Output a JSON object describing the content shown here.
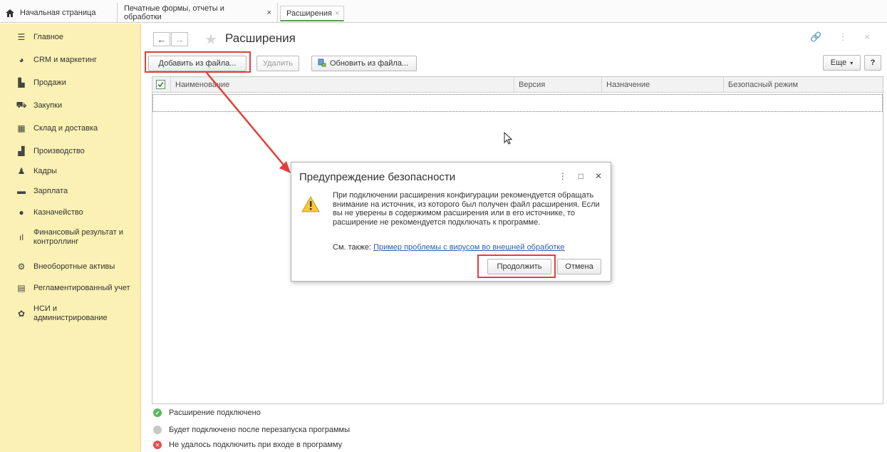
{
  "tabs": [
    {
      "label": "Начальная страница",
      "close": ""
    },
    {
      "label": "Печатные формы, отчеты и обработки",
      "close": "×"
    },
    {
      "label": "Расширения",
      "close": "×"
    }
  ],
  "sidebar": {
    "items": [
      {
        "label": "Главное",
        "icon": "menu-icon"
      },
      {
        "label": "CRM и маркетинг",
        "icon": "pie-chart-icon"
      },
      {
        "label": "Продажи",
        "icon": "shopping-bag-icon"
      },
      {
        "label": "Закупки",
        "icon": "cart-icon"
      },
      {
        "label": "Склад и доставка",
        "icon": "warehouse-icon"
      },
      {
        "label": "Производство",
        "icon": "factory-icon"
      },
      {
        "label": "Кадры",
        "icon": "person-icon"
      },
      {
        "label": "Зарплата",
        "icon": "money-icon"
      },
      {
        "label": "Казначейство",
        "icon": "coin-icon"
      },
      {
        "label": "Финансовый результат и контроллинг",
        "icon": "bar-chart-icon"
      },
      {
        "label": "Внеоборотные активы",
        "icon": "assets-icon"
      },
      {
        "label": "Регламентированный учет",
        "icon": "printer-icon"
      },
      {
        "label": "НСИ и администрирование",
        "icon": "gear-icon"
      }
    ]
  },
  "form": {
    "back": "←",
    "forward": "→",
    "title": "Расширения",
    "header_icons": "🔗 ⋮ ×"
  },
  "toolbar": {
    "add_from_file": "Добавить из файла...",
    "delete": "Удалить",
    "update_from_file": "Обновить из файла...",
    "more": "Еще",
    "help": "?"
  },
  "table": {
    "columns": [
      "Наименование",
      "Версия",
      "Назначение",
      "Безопасный режим"
    ],
    "rows": []
  },
  "legend": [
    {
      "text": "Расширение подключено",
      "color": "#5cb85c",
      "glyph": "✔"
    },
    {
      "text": "Будет подключено после перезапуска программы",
      "color": "#c8c8c8",
      "glyph": ""
    },
    {
      "text": "Не удалось подключить при входе в программу",
      "color": "#e0524e",
      "glyph": "✕"
    }
  ],
  "dialog": {
    "title": "Предупреждение безопасности",
    "message": "При подключении расширения конфигурации рекомендуется обращать внимание на источник, из которого был получен файл расширения. Если вы не уверены в содержимом расширения или в его источнике, то расширение не рекомендуется подключать к программе.",
    "see_also_label": "См. также:",
    "see_also_link": "Пример проблемы с вирусом во внешней обработке",
    "continue": "Продолжить",
    "cancel": "Отмена"
  },
  "colors": {
    "sidebar_bg": "#fbf1b4",
    "highlight": "#e0403a",
    "active_tab_underline": "#5a9e5a",
    "link": "#2a5ea8"
  }
}
